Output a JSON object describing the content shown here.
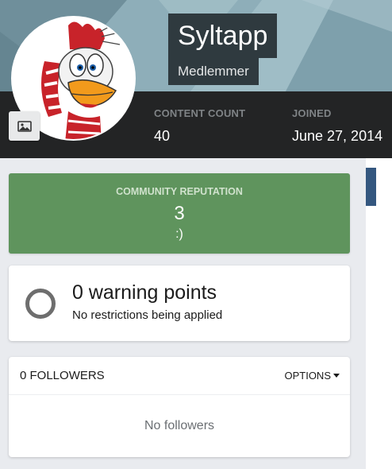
{
  "profile": {
    "username": "Syltapp",
    "group": "Medlemmer",
    "avatar_icon": "rooster-avatar-icon",
    "photo_button_icon": "image-icon"
  },
  "stats": {
    "content_count_label": "CONTENT COUNT",
    "content_count_value": "40",
    "joined_label": "JOINED",
    "joined_value": "June 27, 2014"
  },
  "reputation": {
    "label": "COMMUNITY REPUTATION",
    "value": "3",
    "text": ":)",
    "color": "#5f945d"
  },
  "warnings": {
    "title": "0 warning points",
    "subtitle": "No restrictions being applied"
  },
  "followers": {
    "count_label": "0 FOLLOWERS",
    "options_label": "OPTIONS",
    "empty_text": "No followers"
  },
  "colors": {
    "cover": "#86a7b3",
    "statsbar": "#232425",
    "accent": "#34577f"
  }
}
